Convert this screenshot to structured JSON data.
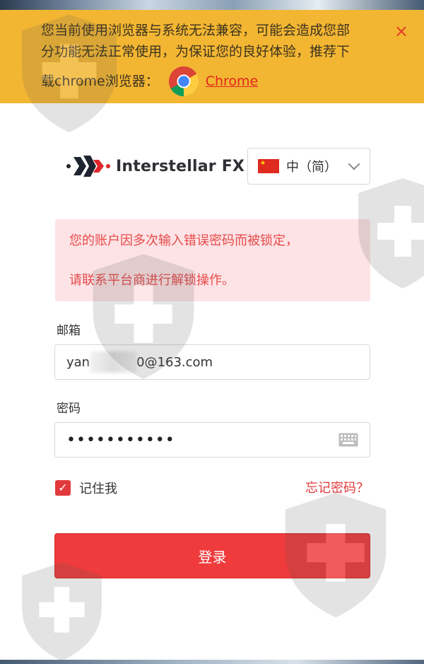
{
  "banner": {
    "message_line1": "您当前使用浏览器与系统无法兼容，可能会造成您部",
    "message_line2": "分功能无法正常使用，为保证您的良好体验，推荐下",
    "message_line3": "载chrome浏览器：",
    "chrome_link": "Chrome",
    "close_symbol": "×",
    "background_color": "#f3b632"
  },
  "header": {
    "brand_name": "Interstellar FX",
    "language": {
      "selected": "中（简）",
      "flag": "china-flag-icon"
    }
  },
  "error": {
    "line1": "您的账户因多次输入错误密码而被锁定，",
    "line2": "请联系平台商进行解锁操作。"
  },
  "form": {
    "email_label": "邮箱",
    "email_value_prefix": "yan",
    "email_value_suffix": "0@163.com",
    "password_label": "密码",
    "password_value": "•••••••••••",
    "remember_label": "记住我",
    "remember_checked": true,
    "forgot_label": "忘记密码？",
    "login_label": "登录"
  },
  "colors": {
    "accent": "#ef3b3c",
    "error_bg": "#fde3e5",
    "error_text": "#e64b4b"
  },
  "icons": {
    "chrome": "chrome-logo-icon",
    "close": "close-icon",
    "dropdown": "chevron-down-icon",
    "keyboard": "keyboard-icon",
    "check": "checkmark-icon",
    "watermark": "shield-plus-icon"
  }
}
